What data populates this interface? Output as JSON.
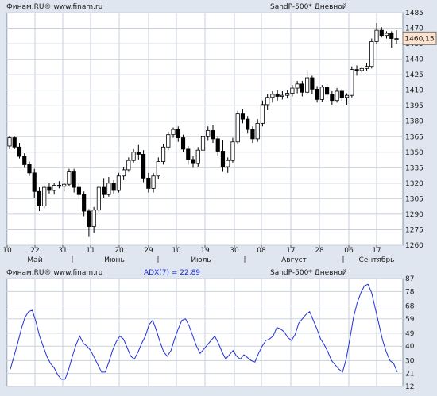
{
  "top_panel": {
    "left_caption": "Финам.RU® www.finam.ru",
    "right_caption": "SandP-500* Дневной"
  },
  "bottom_panel": {
    "left_caption": "Финам.RU® www.finam.ru",
    "indicator_label": "ADX(7) = 22,89",
    "right_caption": "SandP-500* Дневной"
  },
  "colors": {
    "background": "#dfe6ef",
    "plot_bg": "#ffffff",
    "grid": "#c9d2dc",
    "candle_line": "#000000",
    "up_fill": "#ffffff",
    "down_fill": "#000000",
    "adx_line": "#2230d8",
    "price_marker_bg": "#fde3cf"
  },
  "chart_data": [
    {
      "type": "candlestick",
      "title": "SandP-500* Дневной",
      "x_tick_labels": [
        "10",
        "22",
        "31",
        "11",
        "20",
        "29",
        "10",
        "19",
        "30",
        "08",
        "17",
        "28",
        "06",
        "17"
      ],
      "month_labels": [
        "Май",
        "Июнь",
        "Июль",
        "Август",
        "Сентябрь"
      ],
      "y_ticks": [
        1260,
        1275,
        1290,
        1305,
        1320,
        1335,
        1350,
        1365,
        1380,
        1395,
        1410,
        1425,
        1440,
        1455,
        1470,
        1485
      ],
      "ylim": [
        1260,
        1485
      ],
      "grid": true,
      "last_price_label": "1460,15",
      "last_price": 1460.15,
      "ohlc": [
        [
          1356,
          1366,
          1353,
          1364
        ],
        [
          1364,
          1365,
          1353,
          1355
        ],
        [
          1355,
          1359,
          1344,
          1346
        ],
        [
          1346,
          1349,
          1335,
          1338
        ],
        [
          1338,
          1341,
          1327,
          1330
        ],
        [
          1330,
          1334,
          1306,
          1312
        ],
        [
          1312,
          1316,
          1293,
          1298
        ],
        [
          1298,
          1318,
          1296,
          1316
        ],
        [
          1316,
          1320,
          1310,
          1313
        ],
        [
          1313,
          1320,
          1309,
          1318
        ],
        [
          1318,
          1322,
          1315,
          1317
        ],
        [
          1317,
          1320,
          1312,
          1319
        ],
        [
          1319,
          1334,
          1317,
          1331
        ],
        [
          1331,
          1334,
          1311,
          1316
        ],
        [
          1316,
          1320,
          1305,
          1309
        ],
        [
          1309,
          1312,
          1288,
          1293
        ],
        [
          1293,
          1295,
          1268,
          1278
        ],
        [
          1278,
          1297,
          1272,
          1294
        ],
        [
          1294,
          1318,
          1292,
          1316
        ],
        [
          1316,
          1325,
          1306,
          1309
        ],
        [
          1309,
          1326,
          1307,
          1320
        ],
        [
          1320,
          1323,
          1310,
          1313
        ],
        [
          1313,
          1330,
          1311,
          1327
        ],
        [
          1327,
          1336,
          1323,
          1333
        ],
        [
          1333,
          1345,
          1331,
          1342
        ],
        [
          1342,
          1353,
          1340,
          1350
        ],
        [
          1350,
          1357,
          1343,
          1348
        ],
        [
          1348,
          1352,
          1321,
          1325
        ],
        [
          1325,
          1330,
          1311,
          1315
        ],
        [
          1315,
          1330,
          1311,
          1327
        ],
        [
          1327,
          1345,
          1324,
          1341
        ],
        [
          1341,
          1358,
          1338,
          1355
        ],
        [
          1355,
          1370,
          1352,
          1367
        ],
        [
          1367,
          1374,
          1364,
          1372
        ],
        [
          1372,
          1375,
          1360,
          1364
        ],
        [
          1364,
          1367,
          1350,
          1353
        ],
        [
          1353,
          1356,
          1338,
          1343
        ],
        [
          1343,
          1346,
          1335,
          1339
        ],
        [
          1339,
          1355,
          1336,
          1352
        ],
        [
          1352,
          1368,
          1350,
          1365
        ],
        [
          1365,
          1375,
          1361,
          1371
        ],
        [
          1371,
          1376,
          1359,
          1363
        ],
        [
          1363,
          1366,
          1346,
          1351
        ],
        [
          1351,
          1362,
          1331,
          1336
        ],
        [
          1336,
          1345,
          1330,
          1342
        ],
        [
          1342,
          1364,
          1340,
          1360
        ],
        [
          1360,
          1390,
          1358,
          1387
        ],
        [
          1387,
          1392,
          1378,
          1382
        ],
        [
          1382,
          1385,
          1368,
          1372
        ],
        [
          1372,
          1375,
          1359,
          1363
        ],
        [
          1363,
          1382,
          1360,
          1378
        ],
        [
          1378,
          1400,
          1375,
          1396
        ],
        [
          1396,
          1406,
          1391,
          1403
        ],
        [
          1403,
          1409,
          1398,
          1406
        ],
        [
          1406,
          1410,
          1400,
          1404
        ],
        [
          1404,
          1409,
          1401,
          1405
        ],
        [
          1405,
          1410,
          1402,
          1407
        ],
        [
          1407,
          1415,
          1404,
          1412
        ],
        [
          1412,
          1419,
          1407,
          1416
        ],
        [
          1416,
          1419,
          1404,
          1408
        ],
        [
          1408,
          1428,
          1406,
          1422
        ],
        [
          1422,
          1424,
          1406,
          1411
        ],
        [
          1411,
          1414,
          1398,
          1401
        ],
        [
          1401,
          1415,
          1399,
          1413
        ],
        [
          1413,
          1416,
          1403,
          1406
        ],
        [
          1406,
          1409,
          1396,
          1400
        ],
        [
          1400,
          1412,
          1398,
          1409
        ],
        [
          1409,
          1411,
          1400,
          1403
        ],
        [
          1403,
          1407,
          1396,
          1405
        ],
        [
          1405,
          1433,
          1403,
          1430
        ],
        [
          1430,
          1434,
          1424,
          1429
        ],
        [
          1429,
          1433,
          1427,
          1431
        ],
        [
          1431,
          1436,
          1429,
          1433
        ],
        [
          1433,
          1460,
          1431,
          1457
        ],
        [
          1457,
          1475,
          1455,
          1468
        ],
        [
          1468,
          1471,
          1461,
          1463
        ],
        [
          1463,
          1467,
          1460,
          1465
        ],
        [
          1465,
          1467,
          1451,
          1460
        ],
        [
          1460,
          1468,
          1455,
          1460
        ]
      ]
    },
    {
      "type": "line",
      "title": "ADX(7) = 22,89",
      "y_ticks": [
        12,
        21,
        30,
        40,
        49,
        59,
        68,
        78,
        87
      ],
      "ylim": [
        12,
        87
      ],
      "grid": true,
      "series": [
        {
          "name": "ADX(7)",
          "values": [
            24,
            33,
            42,
            52,
            60,
            64,
            65,
            57,
            47,
            40,
            33,
            28,
            25,
            20,
            17,
            17,
            24,
            33,
            41,
            47,
            42,
            40,
            37,
            32,
            27,
            22,
            22,
            29,
            37,
            43,
            47,
            45,
            39,
            33,
            31,
            36,
            42,
            47,
            55,
            58,
            51,
            43,
            36,
            33,
            37,
            45,
            52,
            58,
            59,
            54,
            47,
            40,
            35,
            38,
            41,
            44,
            47,
            42,
            36,
            31,
            34,
            37,
            33,
            31,
            34,
            32,
            30,
            29,
            35,
            40,
            44,
            45,
            47,
            53,
            52,
            50,
            46,
            44,
            48,
            56,
            59,
            62,
            64,
            58,
            52,
            45,
            41,
            36,
            30,
            27,
            24,
            22,
            31,
            45,
            60,
            70,
            77,
            82,
            83,
            77,
            66,
            55,
            44,
            36,
            30,
            28,
            22
          ]
        }
      ]
    }
  ]
}
